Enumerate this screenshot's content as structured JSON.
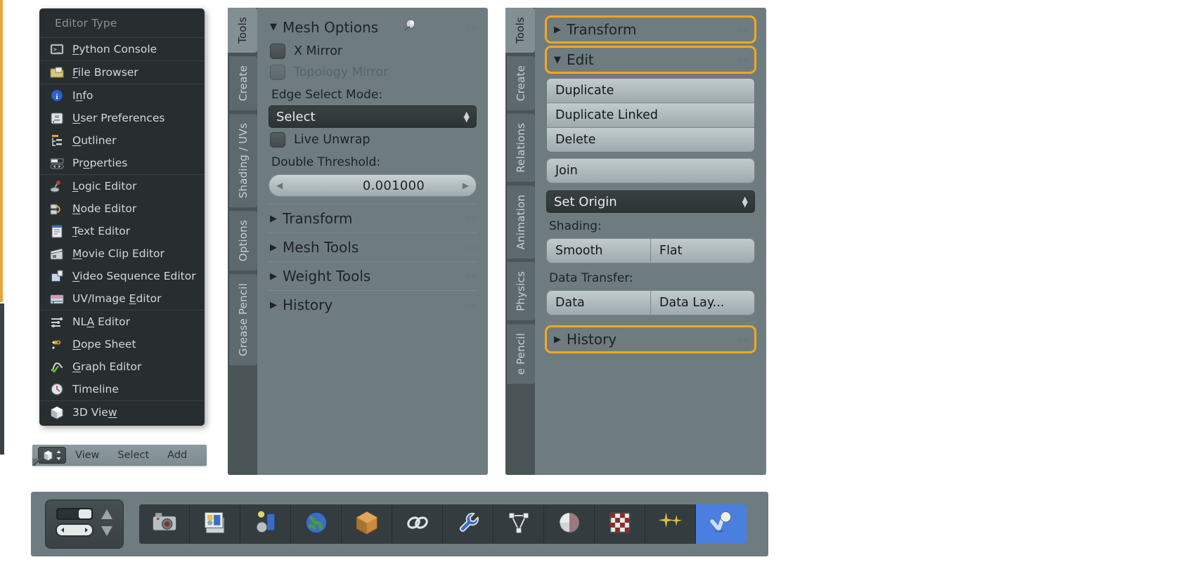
{
  "editor_menu": {
    "title": "Editor Type",
    "groups": [
      {
        "items": [
          {
            "label": "Python Console",
            "accel": "P",
            "icon": "console-icon"
          }
        ]
      },
      {
        "items": [
          {
            "label": "File Browser",
            "accel": "F",
            "icon": "folder-icon"
          }
        ]
      },
      {
        "items": [
          {
            "label": "Info",
            "accel": "n",
            "icon": "info-icon"
          },
          {
            "label": "User Preferences",
            "accel": "U",
            "icon": "preferences-icon"
          },
          {
            "label": "Outliner",
            "accel": "O",
            "icon": "outliner-icon"
          },
          {
            "label": "Properties",
            "accel": "o",
            "icon": "properties-icon"
          }
        ]
      },
      {
        "items": [
          {
            "label": "Logic Editor",
            "accel": "L",
            "icon": "logic-icon"
          },
          {
            "label": "Node Editor",
            "accel": "N",
            "icon": "node-icon"
          },
          {
            "label": "Text Editor",
            "accel": "T",
            "icon": "text-icon"
          },
          {
            "label": "Movie Clip Editor",
            "accel": "M",
            "icon": "movie-clip-icon"
          },
          {
            "label": "Video Sequence Editor",
            "accel": "V",
            "icon": "video-sequence-icon"
          },
          {
            "label": "UV/Image Editor",
            "accel": "E",
            "icon": "uv-image-icon"
          }
        ]
      },
      {
        "items": [
          {
            "label": "NLA Editor",
            "accel": "A",
            "icon": "nla-icon"
          },
          {
            "label": "Dope Sheet",
            "accel": "D",
            "icon": "dope-sheet-icon"
          },
          {
            "label": "Graph Editor",
            "accel": "G",
            "icon": "graph-editor-icon"
          },
          {
            "label": "Timeline",
            "accel": "",
            "icon": "timeline-icon"
          }
        ]
      },
      {
        "items": [
          {
            "label": "3D View",
            "accel": "w",
            "icon": "3d-view-icon"
          }
        ]
      }
    ]
  },
  "mini_header": {
    "editor_selector_icon": "3d-view-icon",
    "menus": [
      "View",
      "Select",
      "Add"
    ]
  },
  "mesh_panel": {
    "tabs": [
      {
        "label": "Tools",
        "active": true
      },
      {
        "label": "Create",
        "active": false
      },
      {
        "label": "Shading / UVs",
        "active": false
      },
      {
        "label": "Options",
        "active": false
      },
      {
        "label": "Grease Pencil",
        "active": false
      }
    ],
    "header": {
      "title": "Mesh Options",
      "expanded": true,
      "pin_icon": "pin-icon",
      "grip_icon": "grip-dots-icon"
    },
    "x_mirror": {
      "label": "X Mirror",
      "checked": false,
      "enabled": true
    },
    "topology_mirror": {
      "label": "Topology Mirror",
      "checked": false,
      "enabled": false
    },
    "edge_select_mode_label": "Edge Select Mode:",
    "edge_select_mode_value": "Select",
    "live_unwrap": {
      "label": "Live Unwrap",
      "checked": false
    },
    "double_threshold_label": "Double Threshold:",
    "double_threshold_value": "0.001000",
    "sections": [
      {
        "title": "Transform",
        "expanded": false
      },
      {
        "title": "Mesh Tools",
        "expanded": false
      },
      {
        "title": "Weight Tools",
        "expanded": false
      },
      {
        "title": "History",
        "expanded": false
      }
    ]
  },
  "object_panel": {
    "tabs": [
      {
        "label": "Tools",
        "active": true
      },
      {
        "label": "Create",
        "active": false
      },
      {
        "label": "Relations",
        "active": false
      },
      {
        "label": "Animation",
        "active": false
      },
      {
        "label": "Physics",
        "active": false
      },
      {
        "label": "e Pencil",
        "active": false
      }
    ],
    "transform_section": {
      "title": "Transform",
      "expanded": false,
      "highlighted": true
    },
    "edit_section": {
      "title": "Edit",
      "expanded": true,
      "highlighted": true
    },
    "buttons": [
      "Duplicate",
      "Duplicate Linked",
      "Delete"
    ],
    "join_button": "Join",
    "set_origin_value": "Set Origin",
    "shading_label": "Shading:",
    "shading_buttons": [
      "Smooth",
      "Flat"
    ],
    "data_transfer_label": "Data Transfer:",
    "data_transfer_buttons": [
      "Data",
      "Data Lay..."
    ],
    "history_section": {
      "title": "History",
      "expanded": false,
      "highlighted": true
    }
  },
  "properties_toolbar": {
    "nav": {
      "render_slot_icon": "render-slot-icon",
      "arrows_icon": "up-down-arrows-icon"
    },
    "tabs": [
      {
        "name": "render-tab",
        "icon": "camera-icon",
        "active": false
      },
      {
        "name": "render-layers-tab",
        "icon": "render-layers-icon",
        "active": false
      },
      {
        "name": "scene-tab",
        "icon": "scene-icon",
        "active": false
      },
      {
        "name": "world-tab",
        "icon": "world-globe-icon",
        "active": false
      },
      {
        "name": "object-tab",
        "icon": "object-cube-icon",
        "active": false
      },
      {
        "name": "constraints-tab",
        "icon": "chain-link-icon",
        "active": false
      },
      {
        "name": "modifiers-tab",
        "icon": "wrench-icon",
        "active": false
      },
      {
        "name": "object-data-tab",
        "icon": "mesh-data-icon",
        "active": false
      },
      {
        "name": "material-tab",
        "icon": "material-sphere-icon",
        "active": false
      },
      {
        "name": "texture-tab",
        "icon": "checker-texture-icon",
        "active": false
      },
      {
        "name": "particles-tab",
        "icon": "particles-icon",
        "active": false
      },
      {
        "name": "physics-tab",
        "icon": "physics-icon",
        "active": true
      }
    ]
  },
  "colors": {
    "panel_bg": "#6e7c80",
    "menu_bg": "#282d30",
    "highlight_orange": "#f5a61e",
    "tab_active": "#828f93",
    "selected_tab_blue": "#4a7fe0"
  }
}
